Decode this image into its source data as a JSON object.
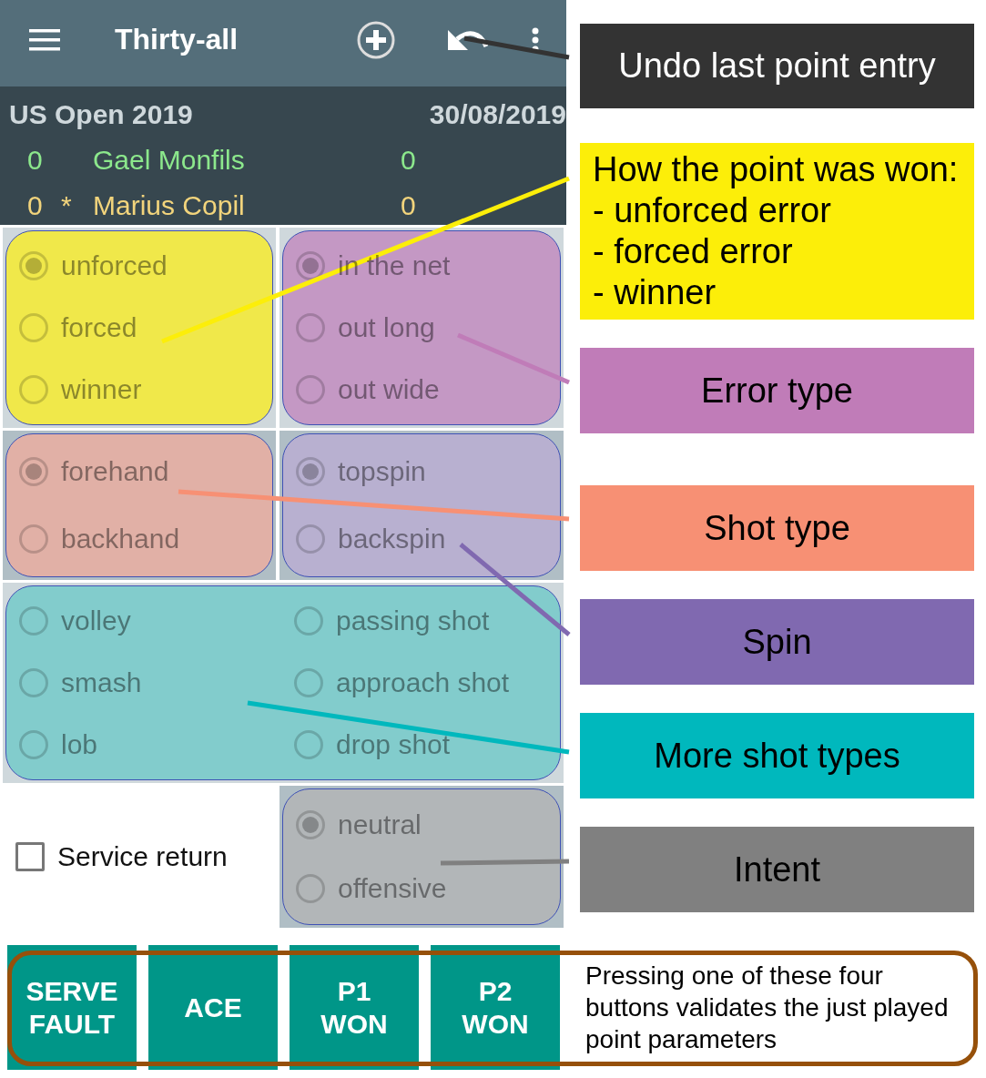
{
  "app_bar": {
    "title": "Thirty-all"
  },
  "match": {
    "tournament": "US Open 2019",
    "date": "30/08/2019",
    "serve_marker": "*"
  },
  "players": [
    {
      "sets": "0",
      "name": "Gael Monfils",
      "points": "0",
      "serving": false,
      "color": "#8ce88c"
    },
    {
      "sets": "0",
      "name": "Marius Copil",
      "points": "0",
      "serving": true,
      "color": "#f2d47c"
    }
  ],
  "panels": [
    {
      "kind": "single",
      "color": "#f0e84a",
      "options": [
        {
          "label": "unforced",
          "selected": true
        },
        {
          "label": "forced",
          "selected": false
        },
        {
          "label": "winner",
          "selected": false
        }
      ]
    },
    {
      "kind": "single",
      "color": "#c498c4",
      "options": [
        {
          "label": "in the net",
          "selected": true
        },
        {
          "label": "out long",
          "selected": false
        },
        {
          "label": "out wide",
          "selected": false
        }
      ]
    },
    {
      "kind": "single",
      "color": "#e1b0a6",
      "options": [
        {
          "label": "forehand",
          "selected": true
        },
        {
          "label": "backhand",
          "selected": false
        }
      ]
    },
    {
      "kind": "single",
      "color": "#b8b0d0",
      "options": [
        {
          "label": "topspin",
          "selected": true
        },
        {
          "label": "backspin",
          "selected": false
        }
      ]
    },
    {
      "kind": "wide",
      "color": "#82cccc",
      "options": [
        {
          "label": "volley",
          "selected": false
        },
        {
          "label": "smash",
          "selected": false
        },
        {
          "label": "lob",
          "selected": false
        },
        {
          "label": "passing shot",
          "selected": false
        },
        {
          "label": "approach shot",
          "selected": false
        },
        {
          "label": "drop shot",
          "selected": false
        }
      ]
    },
    {
      "kind": "single",
      "color": "#b2b6b8",
      "options": [
        {
          "label": "neutral",
          "selected": true
        },
        {
          "label": "offensive",
          "selected": false
        }
      ]
    }
  ],
  "service_return": {
    "label": "Service return",
    "checked": false
  },
  "buttons": [
    {
      "label": "SERVE FAULT"
    },
    {
      "label": "ACE"
    },
    {
      "label": "P1 WON"
    },
    {
      "label": "P2 WON"
    }
  ],
  "callouts": [
    {
      "text": "Undo last point entry",
      "color": "#333333"
    },
    {
      "text": "How the point was won:\n- unforced error\n- forced error\n- winner",
      "color": "#fcee09"
    },
    {
      "text": "Error type",
      "color": "#c07cb8"
    },
    {
      "text": "Shot type",
      "color": "#f79074"
    },
    {
      "text": "Spin",
      "color": "#8069b0"
    },
    {
      "text": "More shot types",
      "color": "#00b8bd"
    },
    {
      "text": "Intent",
      "color": "#808080"
    }
  ],
  "buttons_note": "Pressing one of these four buttons validates the just played point parameters"
}
